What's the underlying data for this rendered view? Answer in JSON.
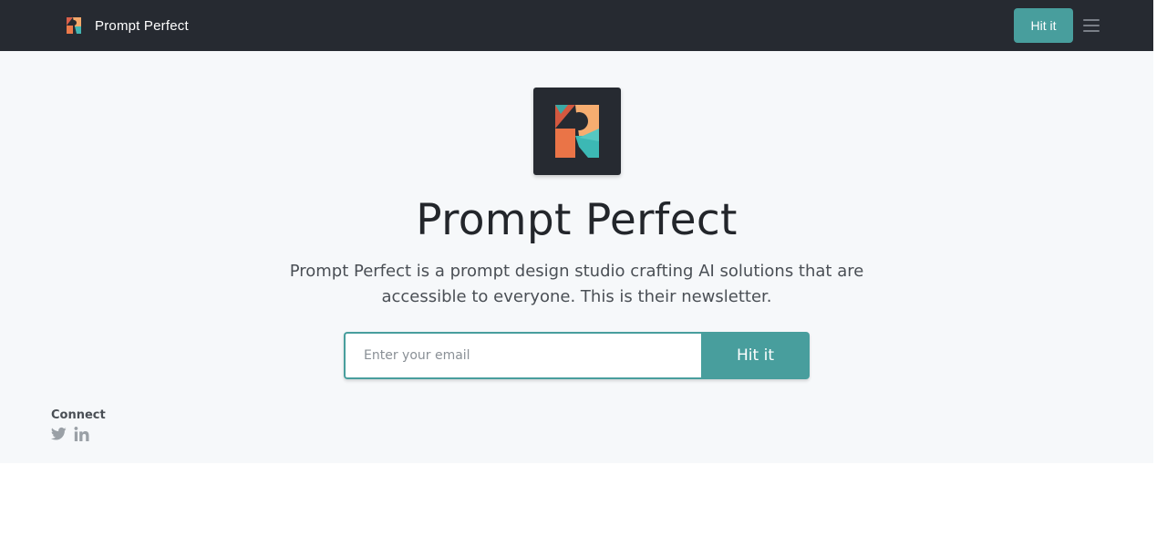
{
  "navbar": {
    "brand_name": "Prompt Perfect",
    "brand_logo_icon": "prompt-perfect-logo",
    "cta_label": "Hit it",
    "menu_icon": "hamburger-menu-icon"
  },
  "hero": {
    "logo_icon": "prompt-perfect-logo",
    "title": "Prompt Perfect",
    "description": "Prompt Perfect is a prompt design studio crafting AI solutions that are accessible to everyone. This is their newsletter."
  },
  "signup": {
    "email_placeholder": "Enter your email",
    "email_value": "",
    "submit_label": "Hit it"
  },
  "footer": {
    "connect_label": "Connect",
    "social_icons": [
      "twitter-icon",
      "linkedin-icon"
    ]
  },
  "colors": {
    "navbar_bg": "#262a31",
    "accent": "#489e9d",
    "page_bg": "#f6f8fa",
    "title_text": "#23262b"
  }
}
